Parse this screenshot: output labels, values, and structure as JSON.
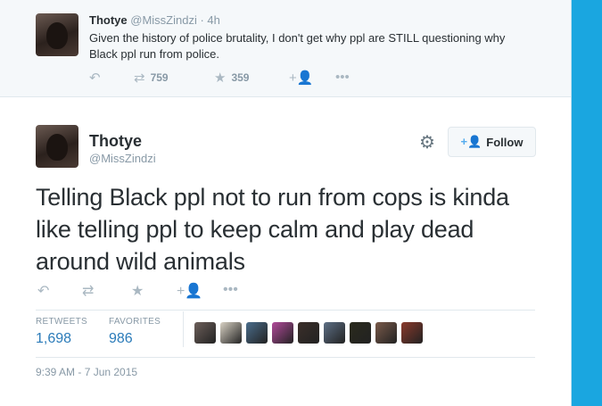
{
  "parent_tweet": {
    "name": "Thotye",
    "handle": "@MissZindzi",
    "time": "· 4h",
    "text": "Given the history of police brutality, I don't get why ppl are STILL questioning why Black ppl run from police.",
    "retweets": "759",
    "favorites": "359",
    "icons": [
      "reply-icon",
      "retweet-icon",
      "favorite-icon",
      "follow-icon",
      "more-icon"
    ]
  },
  "main_tweet": {
    "name": "Thotye",
    "handle": "@MissZindzi",
    "follow_label": "Follow",
    "text": "Telling Black ppl not to run from cops is kinda like telling ppl to keep calm and play dead around wild animals",
    "stats": {
      "retweets_label": "RETWEETS",
      "retweets": "1,698",
      "favorites_label": "FAVORITES",
      "favorites": "986"
    },
    "timestamp": "9:39 AM - 7 Jun 2015",
    "favoriter_avatar_colors": [
      "#6d5f5a",
      "#d9d2c4",
      "#4a6d8c",
      "#b24a9b",
      "#3b2f2a",
      "#5d6f85",
      "#2a2a1c",
      "#7a5a4a",
      "#8b3a2c"
    ]
  },
  "colors": {
    "accent": "#55acee",
    "link": "#2b7bb9",
    "muted": "#8899a6",
    "background": "#1aa6e0"
  }
}
